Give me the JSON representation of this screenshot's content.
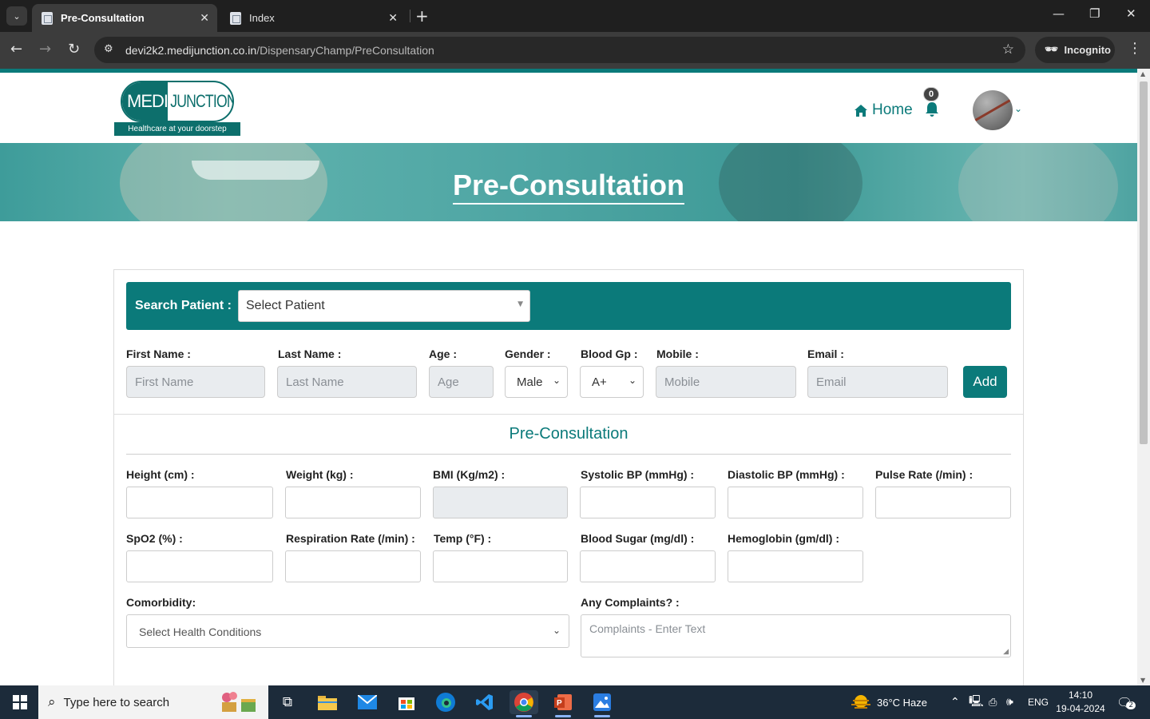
{
  "browser": {
    "tabs": [
      {
        "title": "Pre-Consultation",
        "active": true
      },
      {
        "title": "Index",
        "active": false
      }
    ],
    "url_host": "devi2k2.medijunction.co.in",
    "url_path": "/DispensaryChamp/PreConsultation",
    "profile_label": "Incognito"
  },
  "header": {
    "logo_left": "MEDI",
    "logo_right": "JUNCTION",
    "logo_tagline": "Healthcare at your  doorstep",
    "home_label": "Home",
    "notification_count": "0"
  },
  "banner": {
    "title": "Pre-Consultation"
  },
  "search": {
    "label": "Search Patient :",
    "placeholder": "Select Patient"
  },
  "patient_form": {
    "first_name_label": "First Name :",
    "first_name_placeholder": "First Name",
    "last_name_label": "Last Name :",
    "last_name_placeholder": "Last Name",
    "age_label": "Age :",
    "age_placeholder": "Age",
    "gender_label": "Gender :",
    "gender_value": "Male",
    "blood_label": "Blood Gp :",
    "blood_value": "A+",
    "mobile_label": "Mobile :",
    "mobile_placeholder": "Mobile",
    "email_label": "Email :",
    "email_placeholder": "Email",
    "add_label": "Add"
  },
  "vitals": {
    "section_title": "Pre-Consultation",
    "height_label": "Height (cm) :",
    "weight_label": "Weight (kg) :",
    "bmi_label": "BMI (Kg/m2) :",
    "systolic_label": "Systolic BP (mmHg) :",
    "diastolic_label": "Diastolic BP (mmHg) :",
    "pulse_label": "Pulse Rate (/min) :",
    "spo2_label": "SpO2 (%) :",
    "respiration_label": "Respiration Rate (/min) :",
    "temp_label": "Temp (°F) :",
    "sugar_label": "Blood Sugar (mg/dl) :",
    "hemoglobin_label": "Hemoglobin (gm/dl) :",
    "comorbidity_label": "Comorbidity:",
    "comorbidity_placeholder": "Select Health Conditions",
    "complaints_label": "Any Complaints? :",
    "complaints_placeholder": "Complaints - Enter Text"
  },
  "taskbar": {
    "search_placeholder": "Type here to search",
    "weather": "36°C  Haze",
    "language": "ENG",
    "time": "14:10",
    "date": "19-04-2024",
    "notifications": "2"
  },
  "colors": {
    "brand": "#0b7a7a",
    "taskbar": "#1c2b3a"
  }
}
